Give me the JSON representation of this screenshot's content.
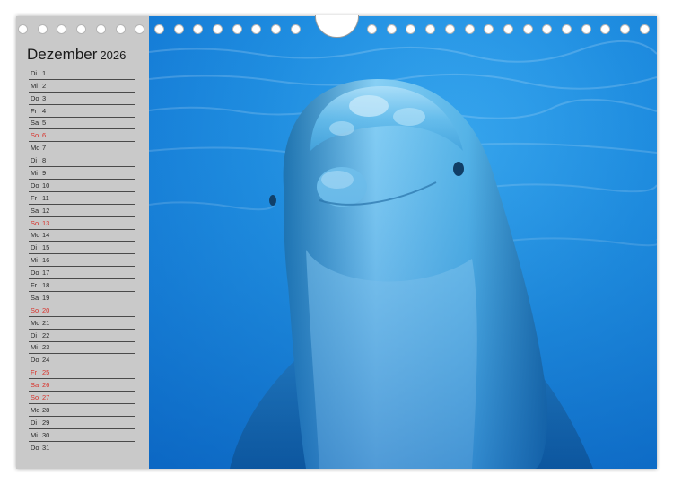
{
  "calendar": {
    "month": "Dezember",
    "year": "2026",
    "days": [
      {
        "wd": "Di",
        "d": "1",
        "holiday": false
      },
      {
        "wd": "Mi",
        "d": "2",
        "holiday": false
      },
      {
        "wd": "Do",
        "d": "3",
        "holiday": false
      },
      {
        "wd": "Fr",
        "d": "4",
        "holiday": false
      },
      {
        "wd": "Sa",
        "d": "5",
        "holiday": false
      },
      {
        "wd": "So",
        "d": "6",
        "holiday": true
      },
      {
        "wd": "Mo",
        "d": "7",
        "holiday": false
      },
      {
        "wd": "Di",
        "d": "8",
        "holiday": false
      },
      {
        "wd": "Mi",
        "d": "9",
        "holiday": false
      },
      {
        "wd": "Do",
        "d": "10",
        "holiday": false
      },
      {
        "wd": "Fr",
        "d": "11",
        "holiday": false
      },
      {
        "wd": "Sa",
        "d": "12",
        "holiday": false
      },
      {
        "wd": "So",
        "d": "13",
        "holiday": true
      },
      {
        "wd": "Mo",
        "d": "14",
        "holiday": false
      },
      {
        "wd": "Di",
        "d": "15",
        "holiday": false
      },
      {
        "wd": "Mi",
        "d": "16",
        "holiday": false
      },
      {
        "wd": "Do",
        "d": "17",
        "holiday": false
      },
      {
        "wd": "Fr",
        "d": "18",
        "holiday": false
      },
      {
        "wd": "Sa",
        "d": "19",
        "holiday": false
      },
      {
        "wd": "So",
        "d": "20",
        "holiday": true
      },
      {
        "wd": "Mo",
        "d": "21",
        "holiday": false
      },
      {
        "wd": "Di",
        "d": "22",
        "holiday": false
      },
      {
        "wd": "Mi",
        "d": "23",
        "holiday": false
      },
      {
        "wd": "Do",
        "d": "24",
        "holiday": false
      },
      {
        "wd": "Fr",
        "d": "25",
        "holiday": true
      },
      {
        "wd": "Sa",
        "d": "26",
        "holiday": true
      },
      {
        "wd": "So",
        "d": "27",
        "holiday": true
      },
      {
        "wd": "Mo",
        "d": "28",
        "holiday": false
      },
      {
        "wd": "Di",
        "d": "29",
        "holiday": false
      },
      {
        "wd": "Mi",
        "d": "30",
        "holiday": false
      },
      {
        "wd": "Do",
        "d": "31",
        "holiday": false
      }
    ]
  },
  "photo": {
    "subject": "dolphin-photo"
  },
  "colors": {
    "sidebar": "#c9c9c9",
    "holiday": "#d8322b",
    "water": "#1f8de0"
  }
}
